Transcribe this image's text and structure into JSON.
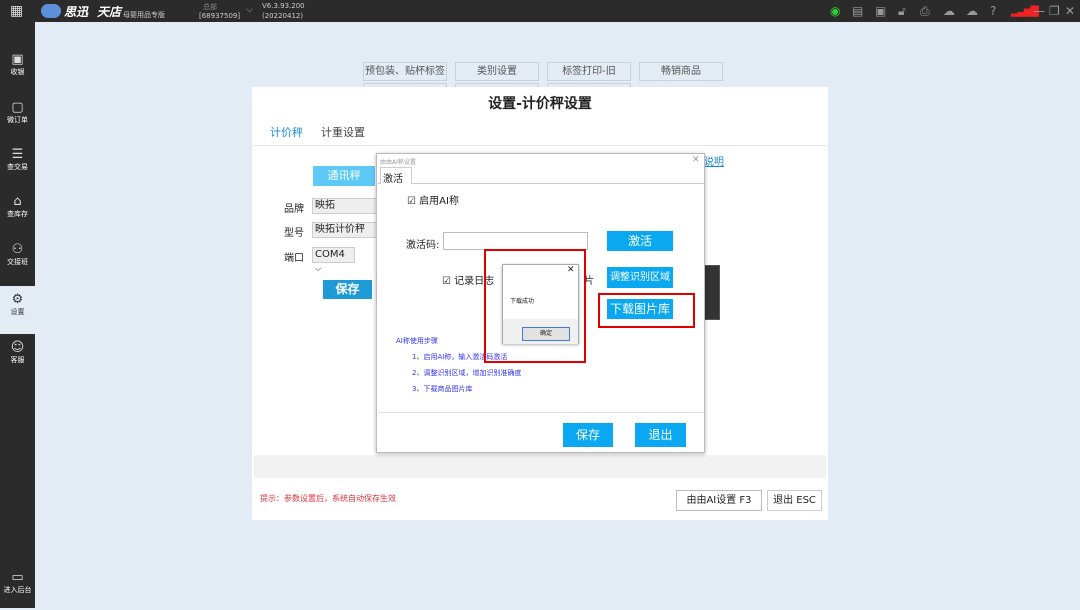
{
  "topbar": {
    "brand": "思迅",
    "brand2": "天店",
    "edition": "母婴用品专版",
    "store": "总部",
    "store_id": "[68937509]",
    "version": "V6.3.93.200",
    "build": "(20220412)",
    "icons": [
      "scale-icon",
      "keyboard-icon",
      "cashbox-icon",
      "lock-icon",
      "printer-icon",
      "cloud-icon",
      "cloud-upload-icon",
      "help-icon",
      "signal-icon",
      "minimize-icon",
      "restore-icon",
      "close-icon"
    ]
  },
  "sidebar": {
    "items": [
      {
        "label": "收银",
        "icon": "cashier-icon"
      },
      {
        "label": "微订单",
        "icon": "order-icon"
      },
      {
        "label": "查交易",
        "icon": "transaction-icon"
      },
      {
        "label": "查库存",
        "icon": "inventory-icon"
      },
      {
        "label": "交接班",
        "icon": "shift-icon"
      },
      {
        "label": "设置",
        "icon": "gear-icon",
        "active": true
      },
      {
        "label": "客服",
        "icon": "support-icon"
      }
    ],
    "backend": "进入后台"
  },
  "top_tabs": [
    "预包装、贴杯标签",
    "类别设置",
    "标签打印-旧",
    "畅销商品"
  ],
  "panel": {
    "title": "设置-计价秤设置",
    "tabs": [
      "计价秤",
      "计重设置"
    ],
    "comm_scale": "通讯秤",
    "brand_label": "品牌",
    "brand_value": "映拓",
    "model_label": "型号",
    "model_value": "映拓计价秤",
    "port_label": "端口",
    "port_value": "COM4",
    "save": "保存",
    "help_link": "说明",
    "tip": "提示：参数设置后，系统自动保存生效",
    "ai_button": "由由AI设置 F3",
    "exit_button": "退出 ESC"
  },
  "dialog": {
    "title": "由由AI称设置",
    "tab": "激活",
    "enable_ai": "启用AI称",
    "enable_checked": true,
    "code_label": "激活码:",
    "code_value": "",
    "activate": "激活",
    "log": "记录日志",
    "log_checked": true,
    "hidden_text": "片",
    "adjust": "调整识别区域",
    "download": "下载图片库",
    "steps_title": "AI称使用步骤",
    "steps": [
      "1、启用AI称，输入激活码激活",
      "2、调整识别区域，增加识别准确度",
      "3、下载商品图片库"
    ],
    "save": "保存",
    "exit": "退出"
  },
  "msgbox": {
    "message": "下载成功",
    "ok": "确定"
  },
  "colors": {
    "accent": "#0aa8f0",
    "highlight": "#e00000",
    "tip": "#e0303a"
  }
}
